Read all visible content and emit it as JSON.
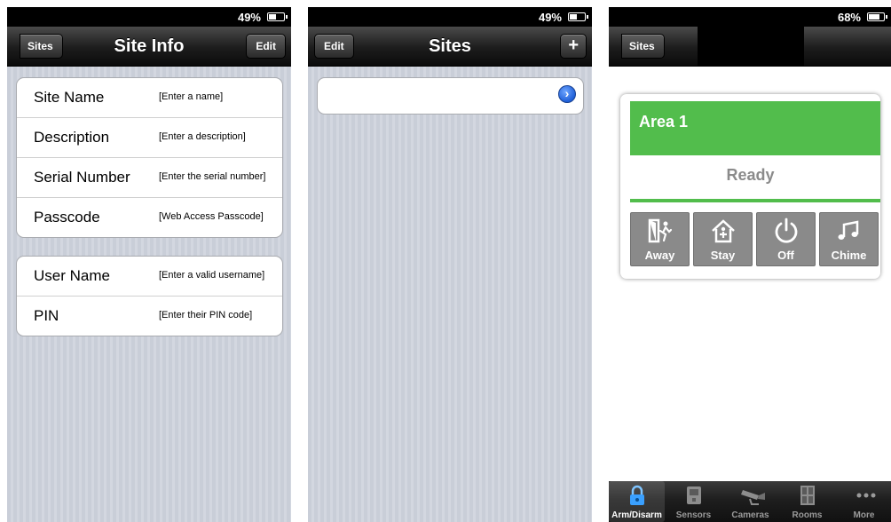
{
  "screen1": {
    "status": {
      "battery": "49%"
    },
    "nav": {
      "back": "Sites",
      "title": "Site Info",
      "edit": "Edit"
    },
    "group1": [
      {
        "label": "Site Name",
        "placeholder": "[Enter a name]"
      },
      {
        "label": "Description",
        "placeholder": "[Enter a description]"
      },
      {
        "label": "Serial Number",
        "placeholder": "[Enter the serial number]"
      },
      {
        "label": "Passcode",
        "placeholder": "[Web Access Passcode]"
      }
    ],
    "group2": [
      {
        "label": "User Name",
        "placeholder": "[Enter a valid username]"
      },
      {
        "label": "PIN",
        "placeholder": "[Enter their PIN code]"
      }
    ]
  },
  "screen2": {
    "status": {
      "battery": "49%"
    },
    "nav": {
      "edit": "Edit",
      "title": "Sites",
      "add": "+"
    }
  },
  "screen3": {
    "status": {
      "battery": "68%"
    },
    "nav": {
      "back": "Sites"
    },
    "area": {
      "name": "Area 1",
      "state": "Ready"
    },
    "actions": [
      "Away",
      "Stay",
      "Off",
      "Chime"
    ],
    "tabs": [
      "Arm/Disarm",
      "Sensors",
      "Cameras",
      "Rooms",
      "More"
    ]
  },
  "colors": {
    "green": "#52bd4c",
    "accent_blue": "#2f7bf0"
  }
}
